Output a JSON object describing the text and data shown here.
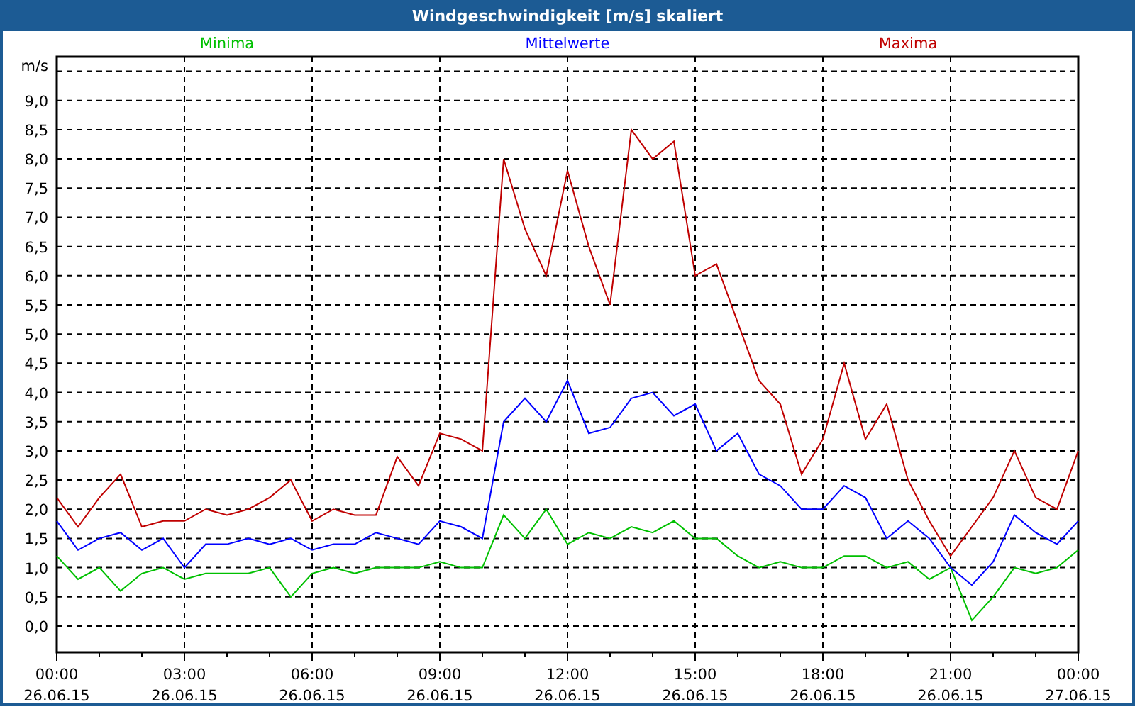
{
  "window": {
    "title": "Windgeschwindigkeit [m/s] skaliert"
  },
  "chart": {
    "chart_data": {
      "type": "line",
      "ylabel": "m/s",
      "categories": [
        "00:00 26.06.15",
        null,
        null,
        null,
        null,
        null,
        "03:00 26.06.15",
        null,
        null,
        null,
        null,
        null,
        "06:00 26.06.15",
        null,
        null,
        null,
        null,
        null,
        "09:00 26.06.15",
        null,
        null,
        null,
        null,
        null,
        "12:00 26.06.15",
        null,
        null,
        null,
        null,
        null,
        "15:00 26.06.15",
        null,
        null,
        null,
        null,
        null,
        "18:00 26.06.15",
        null,
        null,
        null,
        null,
        null,
        "21:00 26.06.15",
        null,
        null,
        null,
        null,
        null,
        "00:00 27.06.15"
      ],
      "series": [
        {
          "name": "Minima",
          "color": "#00c000",
          "values": [
            1.2,
            0.8,
            1.0,
            0.6,
            0.9,
            1.0,
            0.8,
            0.9,
            0.9,
            0.9,
            1.0,
            0.5,
            0.9,
            1.0,
            0.9,
            1.0,
            1.0,
            1.0,
            1.1,
            1.0,
            1.0,
            1.9,
            1.5,
            2.0,
            1.4,
            1.6,
            1.5,
            1.7,
            1.6,
            1.8,
            1.5,
            1.5,
            1.2,
            1.0,
            1.1,
            1.0,
            1.0,
            1.2,
            1.2,
            1.0,
            1.1,
            0.8,
            1.0,
            0.1,
            0.5,
            1.0,
            0.9,
            1.0,
            1.3
          ]
        },
        {
          "name": "Mittelwerte",
          "color": "#0000ff",
          "values": [
            1.8,
            1.3,
            1.5,
            1.6,
            1.3,
            1.5,
            1.0,
            1.4,
            1.4,
            1.5,
            1.4,
            1.5,
            1.3,
            1.4,
            1.4,
            1.6,
            1.5,
            1.4,
            1.8,
            1.7,
            1.5,
            3.5,
            3.9,
            3.5,
            4.2,
            3.3,
            3.4,
            3.9,
            4.0,
            3.6,
            3.8,
            3.0,
            3.3,
            2.6,
            2.4,
            2.0,
            2.0,
            2.4,
            2.2,
            1.5,
            1.8,
            1.5,
            1.0,
            0.7,
            1.1,
            1.9,
            1.6,
            1.4,
            1.8
          ]
        },
        {
          "name": "Maxima",
          "color": "#c00000",
          "values": [
            2.2,
            1.7,
            2.2,
            2.6,
            1.7,
            1.8,
            1.8,
            2.0,
            1.9,
            2.0,
            2.2,
            2.5,
            1.8,
            2.0,
            1.9,
            1.9,
            2.9,
            2.4,
            3.3,
            3.2,
            3.0,
            8.0,
            6.8,
            6.0,
            7.8,
            6.5,
            5.5,
            8.5,
            8.0,
            8.3,
            6.0,
            6.2,
            5.2,
            4.2,
            3.8,
            2.6,
            3.2,
            4.5,
            3.2,
            3.8,
            2.5,
            1.8,
            1.2,
            1.7,
            2.2,
            3.0,
            2.2,
            2.0,
            3.0
          ]
        }
      ],
      "ylim": [
        -0.45,
        9.75
      ],
      "grid": true,
      "yticks": [
        {
          "value": 0,
          "label": "0,0"
        },
        {
          "value": 0.5,
          "label": "0,5"
        },
        {
          "value": 1,
          "label": "1,0"
        },
        {
          "value": 1.5,
          "label": "1,5"
        },
        {
          "value": 2,
          "label": "2,0"
        },
        {
          "value": 2.5,
          "label": "2,5"
        },
        {
          "value": 3,
          "label": "3,0"
        },
        {
          "value": 3.5,
          "label": "3,5"
        },
        {
          "value": 4,
          "label": "4,0"
        },
        {
          "value": 4.5,
          "label": "4,5"
        },
        {
          "value": 5,
          "label": "5,0"
        },
        {
          "value": 5.5,
          "label": "5,5"
        },
        {
          "value": 6,
          "label": "6,0"
        },
        {
          "value": 6.5,
          "label": "6,5"
        },
        {
          "value": 7,
          "label": "7,0"
        },
        {
          "value": 7.5,
          "label": "7,5"
        },
        {
          "value": 8,
          "label": "8,0"
        },
        {
          "value": 8.5,
          "label": "8,5"
        },
        {
          "value": 9,
          "label": "9,0"
        }
      ]
    }
  }
}
